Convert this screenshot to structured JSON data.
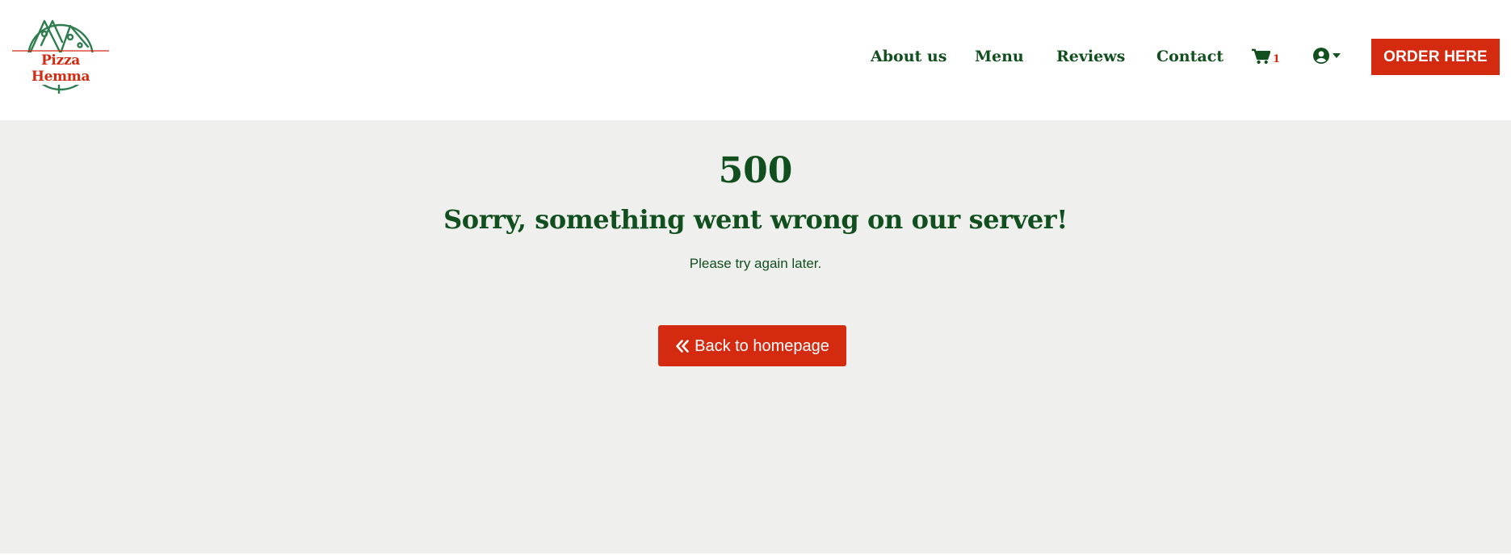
{
  "brand": {
    "name": "Pizza Hemma",
    "logo_icon": "pizza-logo-icon"
  },
  "nav": {
    "items": [
      {
        "label": "About us"
      },
      {
        "label": "Menu"
      },
      {
        "label": "Reviews"
      },
      {
        "label": "Contact"
      }
    ],
    "cart": {
      "icon": "shopping-cart-icon",
      "count": "1"
    },
    "account": {
      "icon": "user-circle-icon",
      "caret": "caret-down-icon"
    },
    "order_button": "ORDER HERE"
  },
  "error": {
    "code": "500",
    "headline": "Sorry, something went wrong on our server!",
    "message": "Please try again later.",
    "back_button": {
      "icon": "double-chevron-left-icon",
      "label": "Back to homepage"
    }
  },
  "colors": {
    "brand_green": "#114f1f",
    "brand_red": "#d42a10",
    "page_background": "#efefed",
    "header_background": "#ffffff"
  }
}
